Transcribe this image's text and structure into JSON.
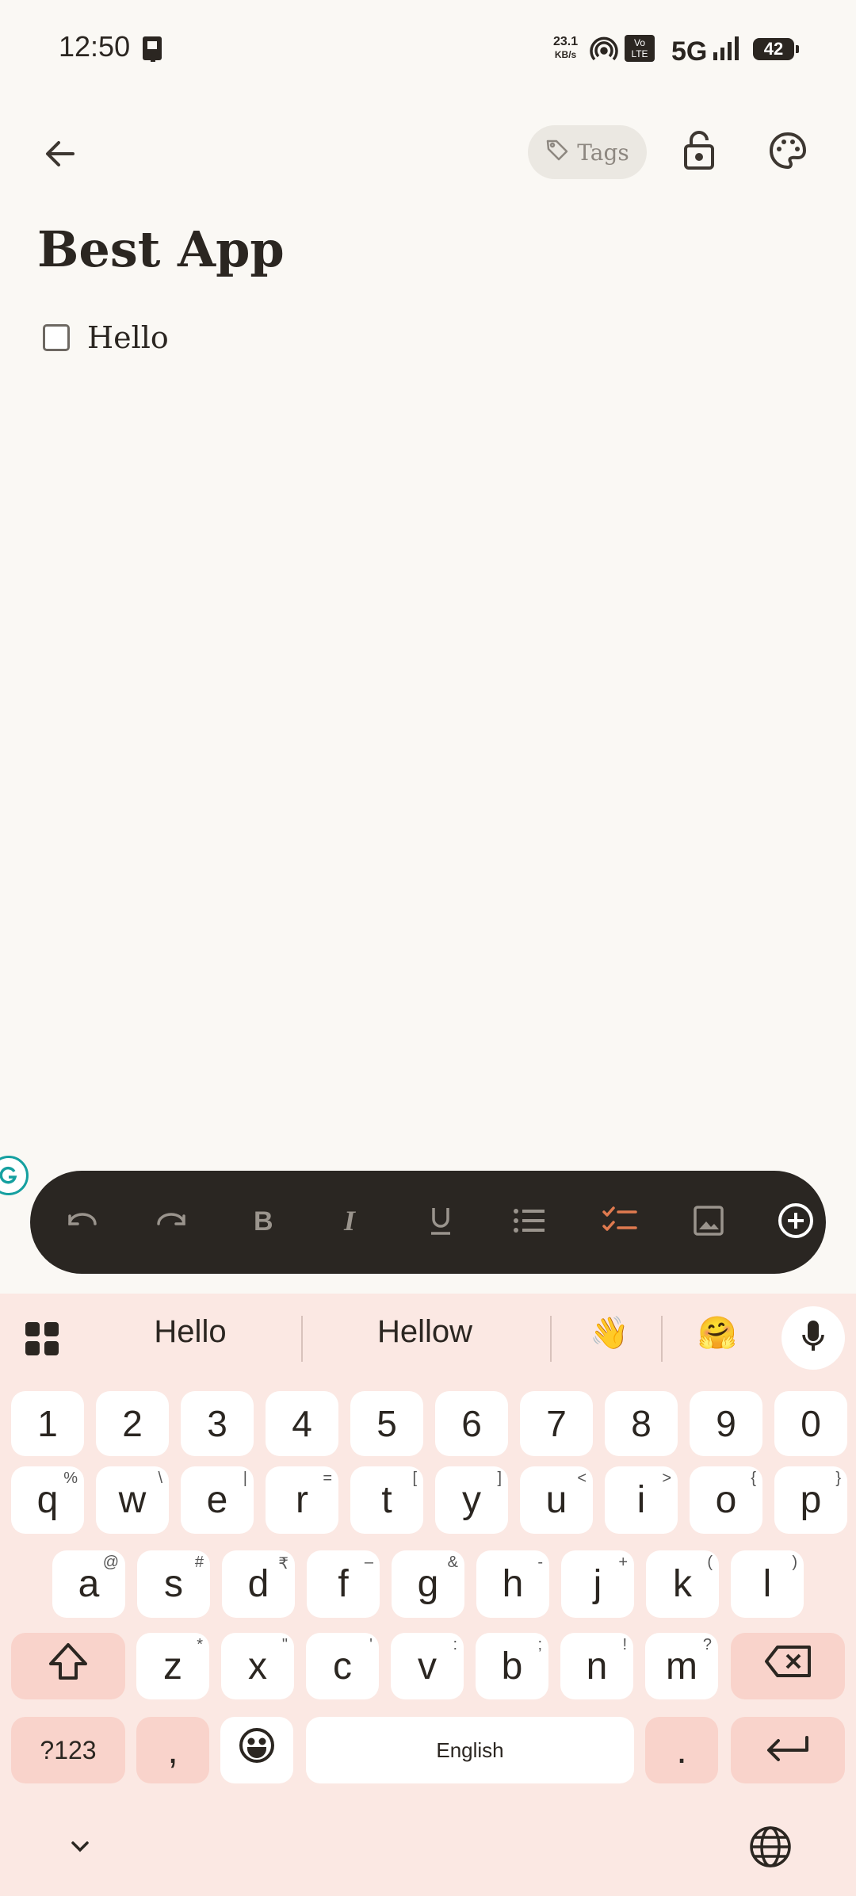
{
  "status_bar": {
    "time": "12:50",
    "net_speed_value": "23.1",
    "net_speed_unit": "KB/s",
    "network": "5G",
    "volte": "Vo LTE",
    "battery": "42"
  },
  "app_bar": {
    "back_icon": "arrow-left-icon",
    "tags_label": "Tags",
    "lock_icon": "lock-open-icon",
    "palette_icon": "palette-icon"
  },
  "note": {
    "title": "Best App",
    "checklist": [
      {
        "text": "Hello",
        "checked": false
      }
    ]
  },
  "toolbar": {
    "items": [
      "undo",
      "redo",
      "bold",
      "italic",
      "underline",
      "bulleted-list",
      "checklist",
      "image",
      "add"
    ],
    "active_color": "#e07a4f"
  },
  "keyboard": {
    "suggestions": [
      "Hello",
      "Hellow",
      "👋",
      "🤗"
    ],
    "numbers": [
      "1",
      "2",
      "3",
      "4",
      "5",
      "6",
      "7",
      "8",
      "9",
      "0"
    ],
    "row1": [
      {
        "k": "q",
        "h": "%"
      },
      {
        "k": "w",
        "h": "\\"
      },
      {
        "k": "e",
        "h": "|"
      },
      {
        "k": "r",
        "h": "="
      },
      {
        "k": "t",
        "h": "["
      },
      {
        "k": "y",
        "h": "]"
      },
      {
        "k": "u",
        "h": "<"
      },
      {
        "k": "i",
        "h": ">"
      },
      {
        "k": "o",
        "h": "{"
      },
      {
        "k": "p",
        "h": "}"
      }
    ],
    "row2": [
      {
        "k": "a",
        "h": "@"
      },
      {
        "k": "s",
        "h": "#"
      },
      {
        "k": "d",
        "h": "₹"
      },
      {
        "k": "f",
        "h": "–"
      },
      {
        "k": "g",
        "h": "&"
      },
      {
        "k": "h",
        "h": "-"
      },
      {
        "k": "j",
        "h": "+"
      },
      {
        "k": "k",
        "h": "("
      },
      {
        "k": "l",
        "h": ")"
      }
    ],
    "row3": [
      {
        "k": "z",
        "h": "*"
      },
      {
        "k": "x",
        "h": "\""
      },
      {
        "k": "c",
        "h": "'"
      },
      {
        "k": "v",
        "h": ":"
      },
      {
        "k": "b",
        "h": ";"
      },
      {
        "k": "n",
        "h": "!"
      },
      {
        "k": "m",
        "h": "?"
      }
    ],
    "sym_label": "?123",
    "comma": ",",
    "space_label": "English",
    "period": "."
  }
}
